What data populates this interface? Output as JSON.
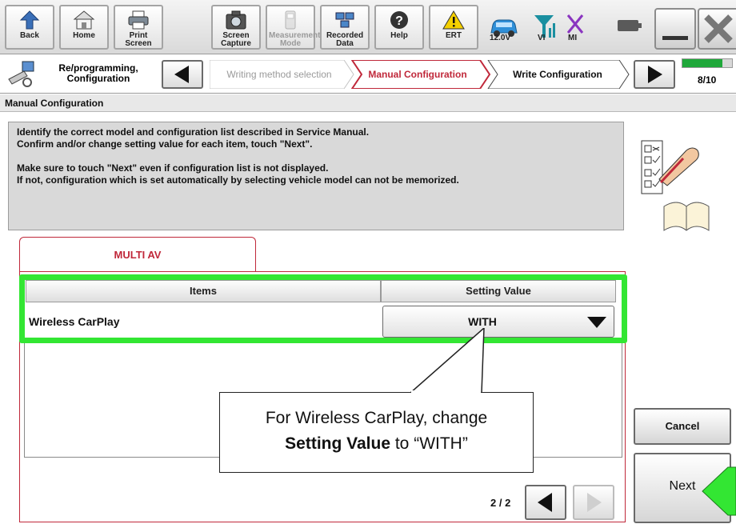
{
  "toolbar": {
    "back": "Back",
    "home": "Home",
    "print_screen": "Print Screen",
    "screen_capture": "Screen Capture",
    "measurement_mode": "Measurement Mode",
    "recorded_data": "Recorded Data",
    "help": "Help",
    "ert": "ERT",
    "voltage": "12.0V",
    "vi": "VI",
    "mi": "MI"
  },
  "steps": {
    "section": "Re/programming, Configuration",
    "writing_method": "Writing method selection",
    "manual_configuration": "Manual Configuration",
    "write_configuration": "Write Configuration",
    "progress_label": "8/10",
    "progress_fraction": 0.8
  },
  "page": {
    "title": "Manual Configuration",
    "instructions": [
      "Identify the correct model and configuration list described in Service Manual.",
      "Confirm and/or change setting value for each item, touch \"Next\".",
      "",
      "Make sure to touch \"Next\" even if configuration list is not displayed.",
      "If not, configuration which is set automatically by selecting vehicle model can not be memorized."
    ]
  },
  "tab": {
    "label": "MULTI AV"
  },
  "table": {
    "headers": [
      "Items",
      "Setting Value"
    ],
    "rows": [
      {
        "item": "Wireless CarPlay",
        "value": "WITH"
      }
    ]
  },
  "callout": {
    "line1": "For Wireless CarPlay, change",
    "line2_bold": "Setting Value",
    "line2_rest": " to “WITH”"
  },
  "pager": {
    "label": "2 / 2"
  },
  "buttons": {
    "cancel": "Cancel",
    "next": "Next"
  },
  "colors": {
    "highlight": "#33e633",
    "accent": "#c0283a",
    "progress": "#1fa83a"
  }
}
